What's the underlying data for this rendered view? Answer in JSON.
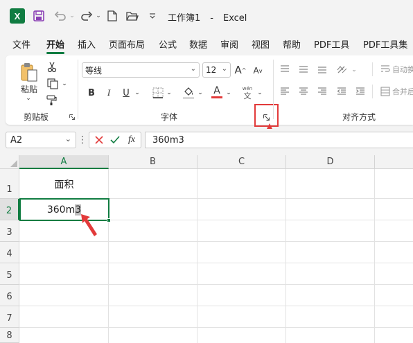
{
  "app": {
    "logo_letter": "X",
    "doc_title": "工作簿1",
    "separator": "-",
    "app_name": "Excel"
  },
  "tabs": [
    "文件",
    "开始",
    "插入",
    "页面布局",
    "公式",
    "数据",
    "审阅",
    "视图",
    "帮助",
    "PDF工具",
    "PDF工具集"
  ],
  "active_tab": "开始",
  "ribbon": {
    "clipboard": {
      "paste_label": "粘贴",
      "group_label": "剪贴板"
    },
    "font": {
      "font_name": "等线",
      "font_size": "12",
      "bold": "B",
      "italic": "I",
      "underline": "U",
      "font_color_letter": "A",
      "phonetic_top": "wén",
      "phonetic_bottom": "文",
      "group_label": "字体"
    },
    "alignment": {
      "wrap_text": "自动换",
      "merge": "合并后",
      "group_label": "对齐方式"
    }
  },
  "formula_bar": {
    "name_box": "A2",
    "fx_label": "fx",
    "formula_value": "360m3"
  },
  "sheet": {
    "columns": [
      "A",
      "B",
      "C",
      "D"
    ],
    "rows": [
      "1",
      "2",
      "3",
      "4",
      "5",
      "6",
      "7",
      "8"
    ],
    "cells": {
      "A1": "面积",
      "A2_prefix": "360m",
      "A2_selected": "3"
    }
  },
  "colors": {
    "accent": "#107c41",
    "highlight_red": "#e23a3a",
    "font_color_bar": "#e23a3a"
  }
}
